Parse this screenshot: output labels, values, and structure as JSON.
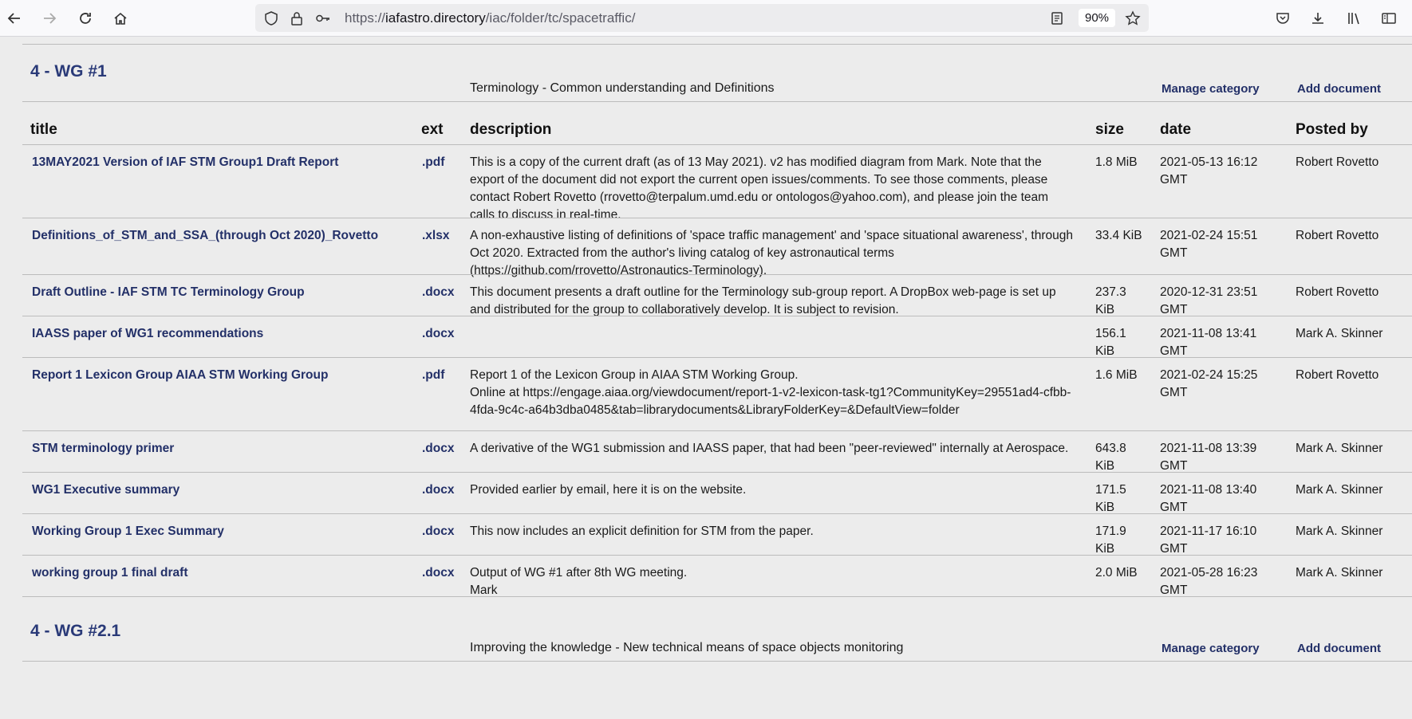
{
  "browser": {
    "url_prefix": "https://",
    "url_host": "iafastro.directory",
    "url_path": "/iac/folder/tc/spacetraffic/",
    "zoom": "90%"
  },
  "categories": [
    {
      "title": "4 - WG #1",
      "description": "Terminology - Common understanding and Definitions",
      "manage_label": "Manage category",
      "add_label": "Add document"
    },
    {
      "title": "4 - WG #2.1",
      "description": "Improving the knowledge - New technical means of space objects monitoring",
      "manage_label": "Manage category",
      "add_label": "Add document"
    }
  ],
  "table": {
    "headers": {
      "title": "title",
      "ext": "ext",
      "description": "description",
      "size": "size",
      "date": "date",
      "posted_by": "Posted by"
    },
    "rows": [
      {
        "title": "13MAY2021 Version of IAF STM Group1 Draft Report",
        "ext": ".pdf",
        "description": "This is a copy of the current draft (as of 13 May 2021). v2 has modified diagram from Mark. Note that the export of the document did not export the current open issues/comments. To see those comments, please contact Robert Rovetto (rrovetto@terpalum.umd.edu or ontologos@yahoo.com), and please join the team calls to discuss in real-time.",
        "size": "1.8 MiB",
        "date": "2021-05-13 16:12 GMT",
        "posted_by": "Robert Rovetto"
      },
      {
        "title": "Definitions_of_STM_and_SSA_(through Oct 2020)_Rovetto",
        "ext": ".xlsx",
        "description": "A non-exhaustive listing of definitions of 'space traffic management' and 'space situational awareness', through Oct 2020. Extracted from the author's living catalog of key astronautical terms (https://github.com/rrovetto/Astronautics-Terminology).",
        "size": "33.4 KiB",
        "date": "2021-02-24 15:51 GMT",
        "posted_by": "Robert Rovetto"
      },
      {
        "title": "Draft Outline - IAF STM TC Terminology Group",
        "ext": ".docx",
        "description": "This document presents a draft outline for the Terminology sub-group report. A DropBox web-page is set up and distributed for the group to collaboratively develop. It is subject to revision.",
        "size": "237.3 KiB",
        "date": "2020-12-31 23:51 GMT",
        "posted_by": "Robert Rovetto"
      },
      {
        "title": "IAASS paper of WG1 recommendations",
        "ext": ".docx",
        "description": "",
        "size": "156.1 KiB",
        "date": "2021-11-08 13:41 GMT",
        "posted_by": "Mark A. Skinner"
      },
      {
        "title": "Report 1 Lexicon Group AIAA STM Working Group",
        "ext": ".pdf",
        "description": "Report 1 of the Lexicon Group in AIAA STM Working Group.\nOnline at https://engage.aiaa.org/viewdocument/report-1-v2-lexicon-task-tg1?CommunityKey=29551ad4-cfbb-4fda-9c4c-a64b3dba0485&tab=librarydocuments&LibraryFolderKey=&DefaultView=folder",
        "size": "1.6 MiB",
        "date": "2021-02-24 15:25 GMT",
        "posted_by": "Robert Rovetto"
      },
      {
        "title": "STM terminology primer",
        "ext": ".docx",
        "description": "A derivative of the WG1 submission and IAASS paper, that had been \"peer-reviewed\" internally at Aerospace.",
        "size": "643.8 KiB",
        "date": "2021-11-08 13:39 GMT",
        "posted_by": "Mark A. Skinner"
      },
      {
        "title": "WG1 Executive summary",
        "ext": ".docx",
        "description": "Provided earlier by email, here it is on the website.",
        "size": "171.5 KiB",
        "date": "2021-11-08 13:40 GMT",
        "posted_by": "Mark A. Skinner"
      },
      {
        "title": "Working Group 1 Exec Summary",
        "ext": ".docx",
        "description": "This now includes an explicit definition for STM from the paper.",
        "size": "171.9 KiB",
        "date": "2021-11-17 16:10 GMT",
        "posted_by": "Mark A. Skinner"
      },
      {
        "title": "working group 1 final draft",
        "ext": ".docx",
        "description": "Output of WG #1 after 8th WG meeting.\nMark",
        "size": "2.0 MiB",
        "date": "2021-05-28 16:23 GMT",
        "posted_by": "Mark A. Skinner"
      }
    ]
  }
}
